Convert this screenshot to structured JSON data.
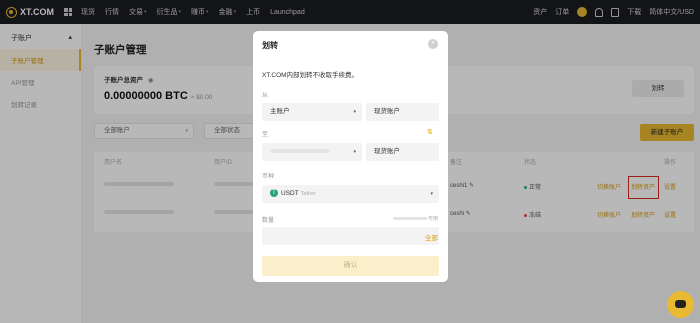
{
  "topnav": {
    "brand": "XT.COM",
    "items": [
      {
        "label": "现货"
      },
      {
        "label": "行情"
      },
      {
        "label": "交易",
        "caret": "▾"
      },
      {
        "label": "衍生品",
        "caret": "▾"
      },
      {
        "label": "赚币",
        "caret": "▾"
      },
      {
        "label": "金融",
        "caret": "▾"
      },
      {
        "label": "上币"
      },
      {
        "label": "Launchpad"
      }
    ],
    "right": {
      "assets": "资产",
      "orders": "订单",
      "download": "下载",
      "language": "简体中文/USD"
    }
  },
  "sidebar": {
    "group": "子账户",
    "group_caret": "▴",
    "items": [
      {
        "label": "子账户管理",
        "active": true
      },
      {
        "label": "API管理",
        "active": false
      },
      {
        "label": "划转记录",
        "active": false
      }
    ]
  },
  "main": {
    "title": "子账户管理",
    "summary": {
      "label": "子账户总资产",
      "value": "0.00000000 BTC",
      "fiat": "≈ $0.00",
      "cut_text": "是",
      "transfer_button": "划转"
    },
    "filters": {
      "account": "全部账户",
      "status": "全部状态",
      "caret": "▾"
    },
    "new_button": "新建子账户",
    "table": {
      "headers": [
        "用户名",
        "用户ID",
        "备注",
        "状态",
        "操作"
      ],
      "rows": [
        {
          "remark": "ceshi1",
          "status": "正常",
          "status_color": "#2fb36a",
          "actions": [
            "切换账户",
            "划转资产",
            "设置"
          ]
        },
        {
          "remark": "ceshi",
          "status": "冻结",
          "status_color": "#e0464a",
          "actions": [
            "切换账户",
            "划转资产",
            "设置"
          ]
        }
      ]
    }
  },
  "modal": {
    "title": "划转",
    "close": "×",
    "note": "XT.COM内部划转不收取手续费。",
    "from_label": "从",
    "from_account": "主账户",
    "from_wallet": "现货账户",
    "to_label": "至",
    "to_wallet": "现货账户",
    "swap_glyph": "⇅",
    "coin_label": "币种",
    "coin_symbol": "USDT",
    "coin_name": "Tether",
    "coin_glyph": "T",
    "amount_label": "数量",
    "available_suffix": "可用",
    "all_button": "全部",
    "confirm_button": "确认",
    "caret": "▾"
  },
  "colors": {
    "accent": "#e8b931",
    "link": "#d49a12",
    "highlight": "#d62b1f"
  }
}
